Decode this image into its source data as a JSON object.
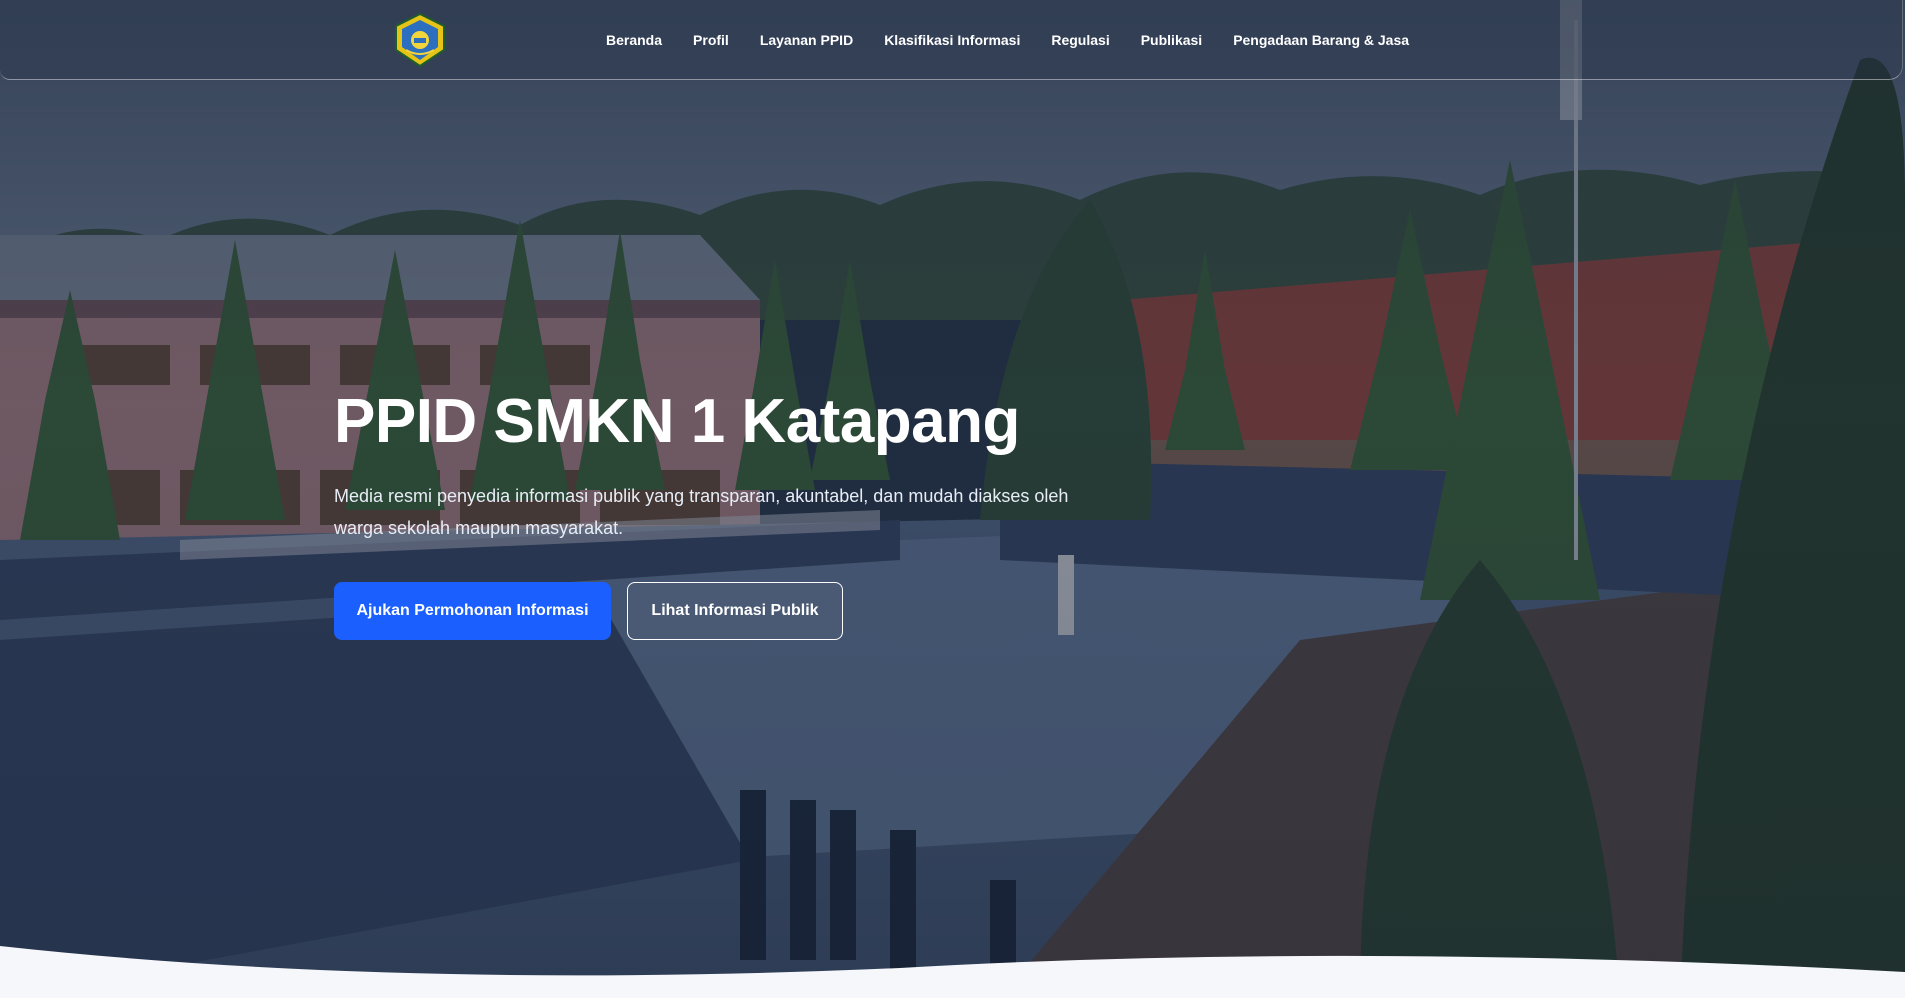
{
  "colors": {
    "primary_button": "#1b5fff",
    "text": "#ffffff",
    "overlay": "#1b2638",
    "wave": "#f5f7fb"
  },
  "logo": {
    "icon": "school-emblem-icon"
  },
  "nav": {
    "items": [
      {
        "label": "Beranda"
      },
      {
        "label": "Profil"
      },
      {
        "label": "Layanan PPID"
      },
      {
        "label": "Klasifikasi Informasi"
      },
      {
        "label": "Regulasi"
      },
      {
        "label": "Publikasi"
      },
      {
        "label": "Pengadaan Barang & Jasa"
      }
    ]
  },
  "hero": {
    "title": "PPID SMKN 1 Katapang",
    "description": "Media resmi penyedia informasi publik yang transparan, akuntabel, dan mudah diakses oleh warga sekolah maupun masyarakat.",
    "primary_button": "Ajukan Permohonan Informasi",
    "secondary_button": "Lihat Informasi Publik"
  }
}
